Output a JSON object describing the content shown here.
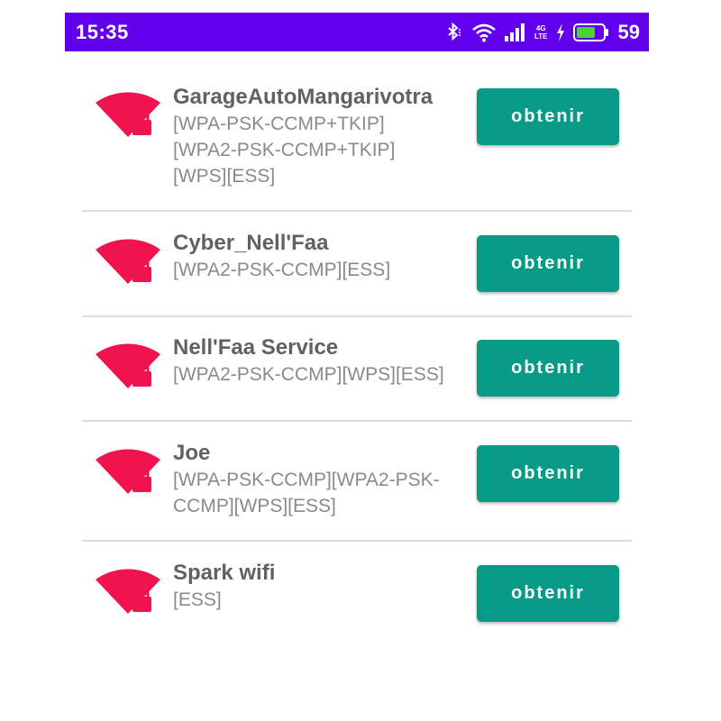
{
  "status_bar": {
    "time": "15:35",
    "network_top": "4G",
    "network_bottom": "LTE",
    "battery_percent": "59",
    "icons": [
      "bluetooth-icon",
      "wifi-icon",
      "signal-icon",
      "charging-icon",
      "battery-icon"
    ]
  },
  "colors": {
    "status_bar": "#6200ee",
    "button": "#069a87",
    "wifi_icon": "#f0134d",
    "ssid_text": "#616161",
    "caps_text": "#8a8a8a"
  },
  "networks": [
    {
      "ssid": "GarageAutoMangarivotra",
      "capabilities": "[WPA-PSK-CCMP+TKIP]\n[WPA2-PSK-CCMP+TKIP]\n[WPS][ESS]",
      "button_label": "obtenir"
    },
    {
      "ssid": "Cyber_Nell'Faa",
      "capabilities": "[WPA2-PSK-CCMP][ESS]",
      "button_label": "obtenir"
    },
    {
      "ssid": "Nell'Faa Service",
      "capabilities": "[WPA2-PSK-CCMP][WPS][ESS]",
      "button_label": "obtenir"
    },
    {
      "ssid": "Joe",
      "capabilities": "[WPA-PSK-CCMP][WPA2-PSK-\nCCMP][WPS][ESS]",
      "button_label": "obtenir"
    },
    {
      "ssid": "Spark wifi",
      "capabilities": "[ESS]",
      "button_label": "obtenir"
    }
  ]
}
